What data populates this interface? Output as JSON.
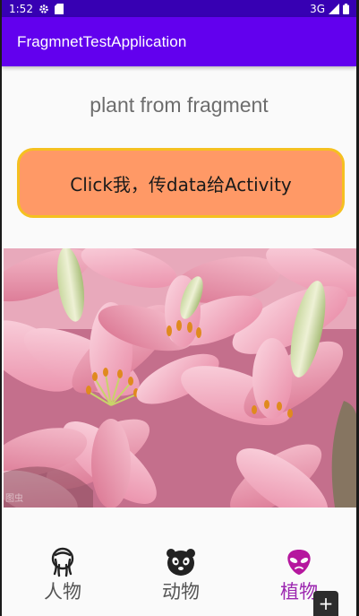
{
  "status_bar": {
    "time": "1:52",
    "network": "3G"
  },
  "app_bar": {
    "title": "FragmnetTestApplication"
  },
  "fragment": {
    "text": "plant from fragment",
    "button_label": "Click我，传data给Activity"
  },
  "image": {
    "watermark": "图虫"
  },
  "bottom_nav": {
    "items": [
      {
        "label": "人物",
        "icon": "person-icon",
        "active": false
      },
      {
        "label": "动物",
        "icon": "panda-icon",
        "active": false
      },
      {
        "label": "植物",
        "icon": "alien-plant-icon",
        "active": true
      }
    ],
    "active_color": "#9c27b0"
  },
  "colors": {
    "status_bar": "#3700b3",
    "app_bar": "#6200ee",
    "button_fill": "#ff9966",
    "button_border": "#f5c020"
  }
}
